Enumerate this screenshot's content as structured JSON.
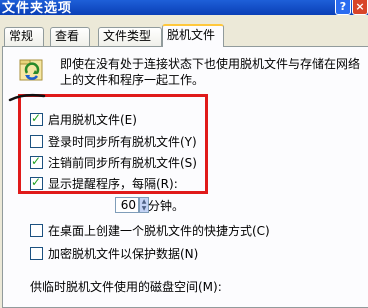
{
  "window": {
    "title": "文件夹选项",
    "help_button": "?",
    "close_button": "×"
  },
  "tabs": [
    {
      "label": "常规"
    },
    {
      "label": "查看"
    },
    {
      "label": "文件类型"
    },
    {
      "label": "脱机文件"
    }
  ],
  "description": "即使在没有处于连接状态下也使用脱机文件与存储在网络上的文件和程序一起工作。",
  "options": {
    "enable_offline": {
      "label": "启用脱机文件(E)",
      "checked": true
    },
    "sync_at_logon": {
      "label": "登录时同步所有脱机文件(Y)",
      "checked": false
    },
    "sync_at_logoff": {
      "label": "注销前同步所有脱机文件(S)",
      "checked": true
    },
    "show_reminder": {
      "label": "显示提醒程序，每隔(R):",
      "checked": true
    },
    "desktop_shortcut": {
      "label": "在桌面上创建一个脱机文件的快捷方式(C)",
      "checked": false
    },
    "encrypt": {
      "label": "加密脱机文件以保护数据(N)",
      "checked": false
    }
  },
  "reminder": {
    "interval_value": "60",
    "interval_unit": "分钟。"
  },
  "disk_space_label": "供临时脱机文件使用的磁盘空间(M):",
  "colors": {
    "highlight_box": "#e01a1a",
    "tab_active_accent": "#ffc83c",
    "titlebar": "#0a3fb6"
  }
}
